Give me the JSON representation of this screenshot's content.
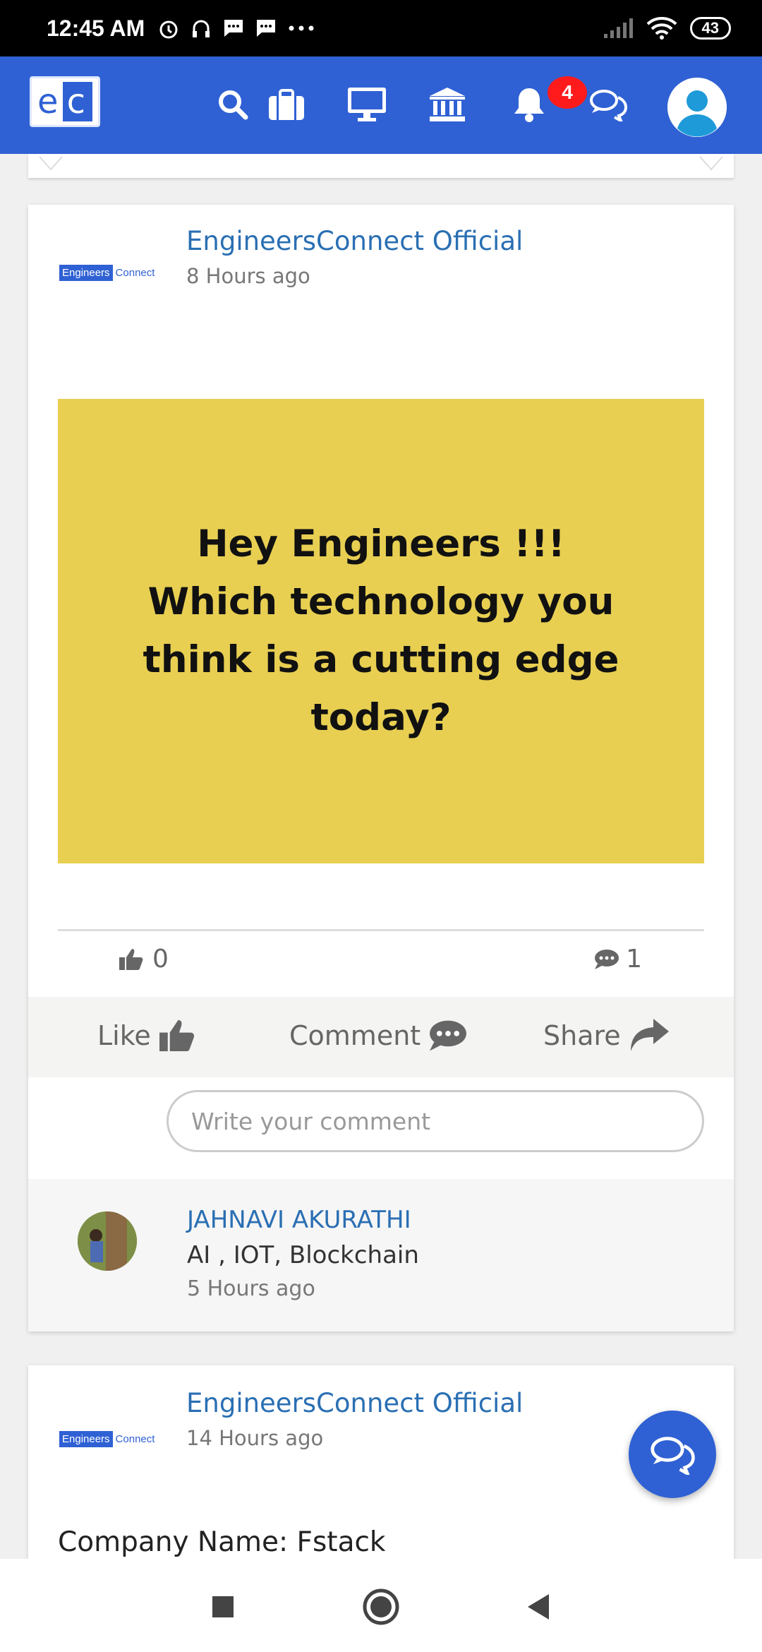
{
  "status_bar": {
    "time": "12:45 AM",
    "battery": "43"
  },
  "header": {
    "logo_text_e": "e",
    "logo_text_c": "c",
    "notification_count": "4",
    "icons": [
      "search-icon",
      "briefcase-icon",
      "monitor-icon",
      "bank-icon",
      "bell-icon",
      "chat-icon",
      "profile-avatar"
    ],
    "brand_color": "#2f61d4"
  },
  "posts": [
    {
      "brand_left": "Engineers",
      "brand_right": "Connect",
      "author": "EngineersConnect Official",
      "time": "8 Hours ago",
      "image_text": "Hey Engineers !!! Which technology you think is a cutting edge today?",
      "likes": "0",
      "comments": "1",
      "actions": {
        "like": "Like",
        "comment": "Comment",
        "share": "Share"
      },
      "comment_placeholder": "Write your comment",
      "top_comment": {
        "name": "JAHNAVI AKURATHI",
        "text": "AI , IOT, Blockchain",
        "time": "5 Hours ago"
      }
    },
    {
      "brand_left": "Engineers",
      "brand_right": "Connect",
      "author": "EngineersConnect Official",
      "time": "14 Hours ago",
      "body": "Company Name: Fstack"
    }
  ]
}
